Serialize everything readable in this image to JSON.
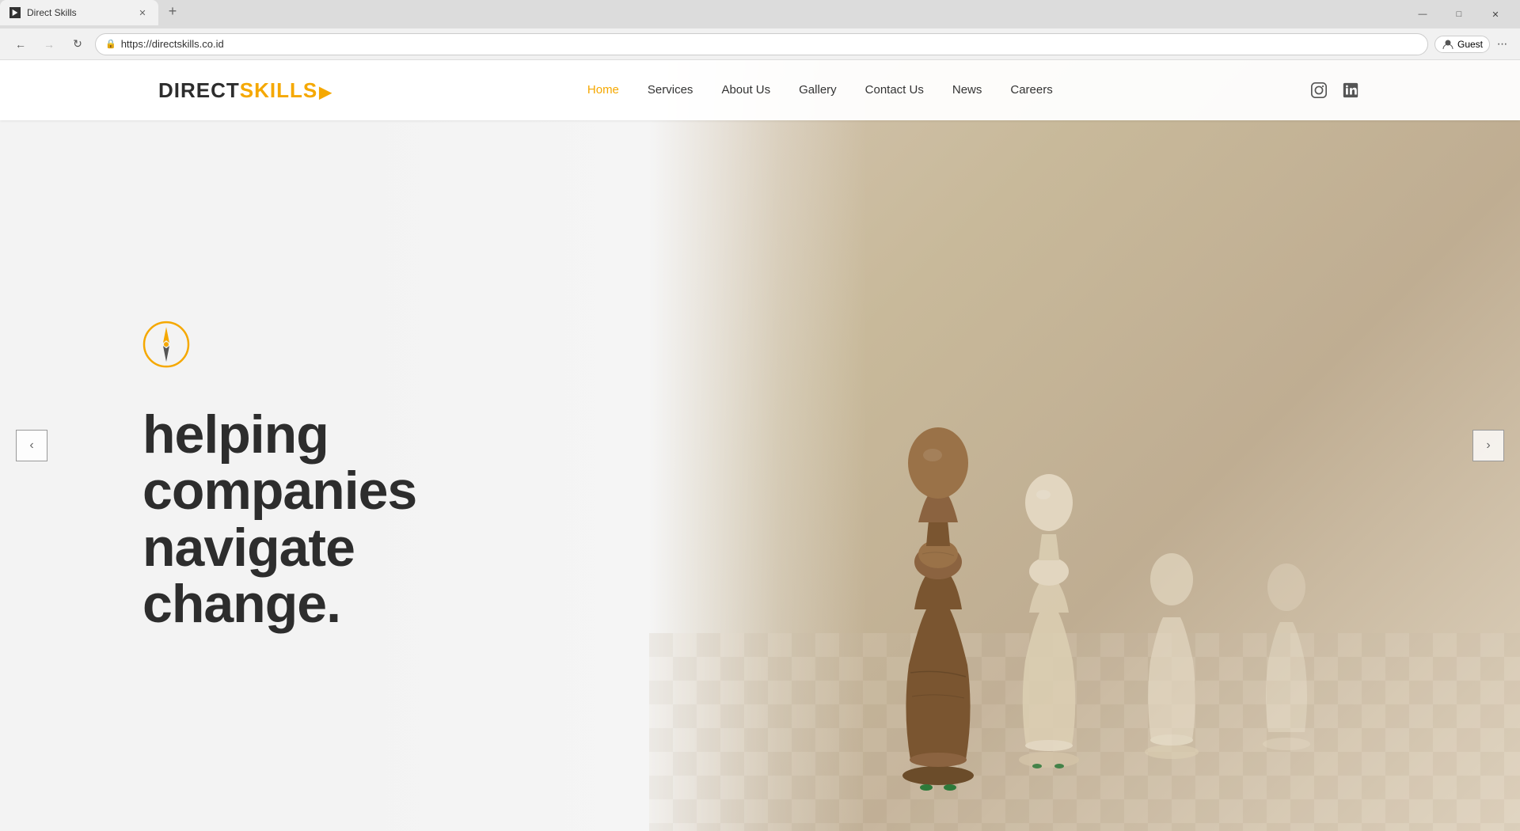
{
  "browser": {
    "tab_title": "Direct Skills",
    "url": "https://directskills.co.id",
    "favicon_text": "▶",
    "new_tab_label": "+",
    "back_disabled": false,
    "forward_disabled": true,
    "refresh_label": "⟳",
    "lock_icon": "🔒",
    "guest_label": "Guest",
    "window_controls": {
      "minimize": "—",
      "maximize": "□",
      "close": "✕"
    },
    "dots_label": "···"
  },
  "site": {
    "logo": {
      "direct": "DIRECT",
      "skills": "SKILLS",
      "arrow": "▶"
    },
    "nav": {
      "home": "Home",
      "services": "Services",
      "about": "About Us",
      "gallery": "Gallery",
      "contact": "Contact Us",
      "news": "News",
      "careers": "Careers"
    },
    "hero": {
      "heading_line1": "helping",
      "heading_line2": "companies",
      "heading_line3": "navigate",
      "heading_line4": "change."
    },
    "carousel": {
      "prev_arrow": "‹",
      "next_arrow": "›"
    },
    "colors": {
      "accent": "#f5a800",
      "dark": "#2d2d2d",
      "nav_active": "#f5a800"
    }
  }
}
